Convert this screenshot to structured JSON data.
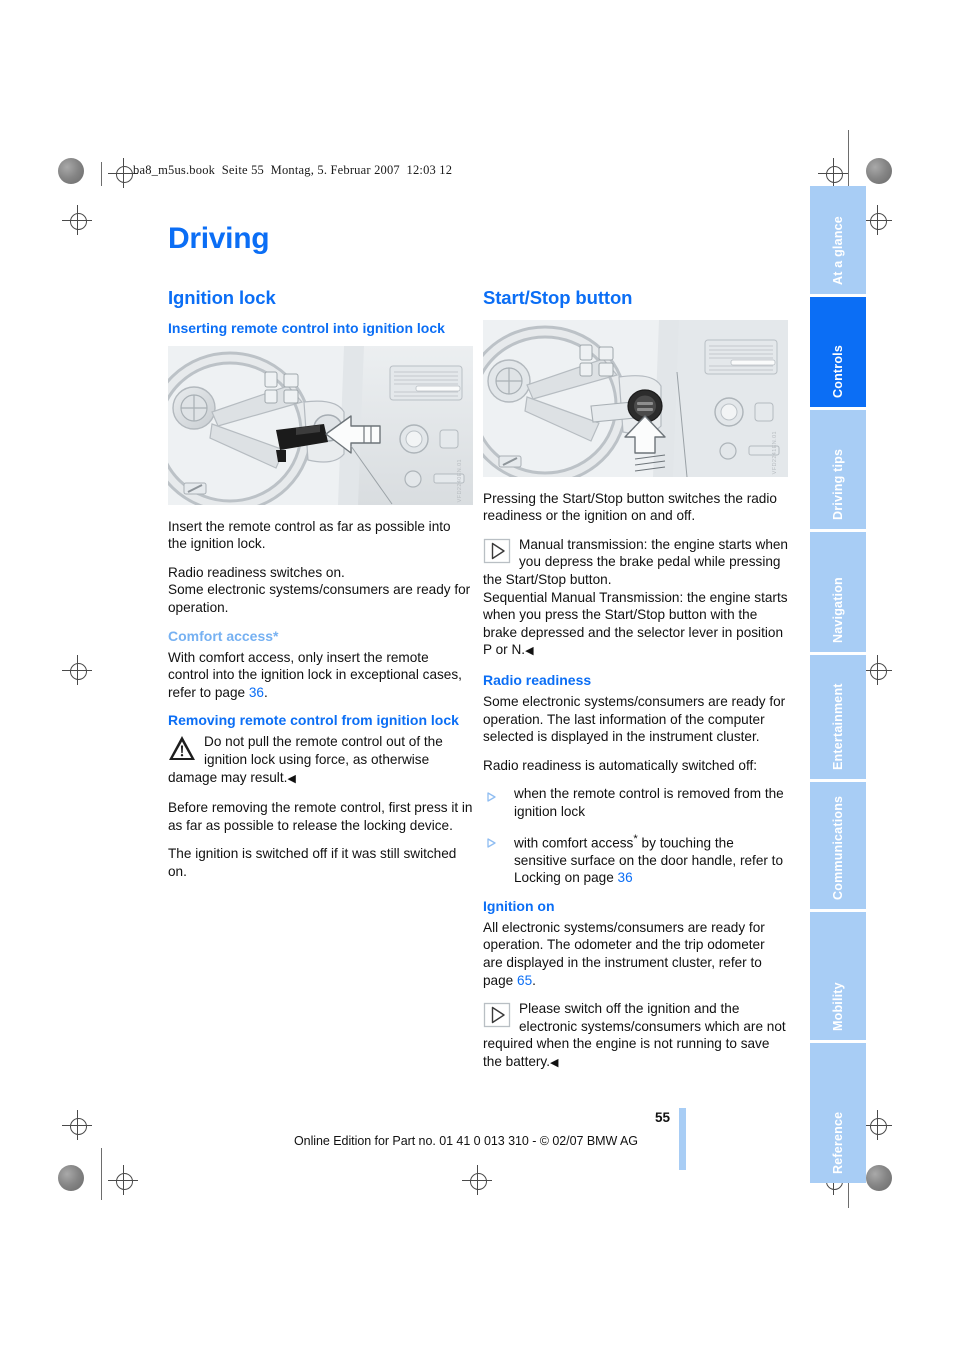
{
  "document": {
    "slug": "ba8_m5us.book  Seite 55  Montag, 5. Februar 2007  12:03 12",
    "chapter_title": "Driving",
    "page_number": "55",
    "footer": "Online Edition for Part no. 01 41 0 013 310 - © 02/07 BMW AG"
  },
  "left_column": {
    "section_title": "Ignition lock",
    "sub1_title": "Inserting remote control into ignition lock",
    "figure1_watermark": "VFD2240EN.01",
    "p1": "Insert the remote control as far as possible into the ignition lock.",
    "p2": "Radio readiness switches on.\nSome electronic systems/consumers are ready for operation.",
    "sub2_title": "Comfort access*",
    "p3_pre": "With comfort access, only insert the remote control into the ignition lock in exceptional cases, refer to page ",
    "p3_ref": "36",
    "p3_post": ".",
    "sub3_title": "Removing remote control from ignition lock",
    "warning_icon": "warning-triangle-icon",
    "warning_text": "Do not pull the remote control out of the ignition lock using force, as otherwise damage may result.",
    "warning_endmark": "◀",
    "p4": "Before removing the remote control, first press it in as far as possible to release the locking device.",
    "p5": "The ignition is switched off if it was still switched on."
  },
  "right_column": {
    "section_title": "Start/Stop button",
    "figure2_watermark": "VFD2241EN.01",
    "p1": "Pressing the Start/Stop button switches the radio readiness or the ignition on and off.",
    "note1_icon": "info-triangle-icon",
    "note1_text": "Manual transmission: the engine starts when you depress the brake pedal while pressing the Start/Stop button.\nSequential Manual Transmission: the engine starts when you press the Start/Stop button with the brake depressed and the selector lever in position P or N.",
    "note1_endmark": "◀",
    "sub1_title": "Radio readiness",
    "p2": "Some electronic systems/consumers are ready for operation. The last information of the computer selected is displayed in the instrument cluster.",
    "p3": "Radio readiness is automatically switched off:",
    "bullets": [
      {
        "text": "when the remote control is removed from the ignition lock"
      },
      {
        "text_pre": "with comfort access",
        "star": "*",
        "text_mid": " by touching the sensitive surface on the door handle, refer to Locking on page ",
        "ref": "36",
        "text_post": ""
      }
    ],
    "sub2_title": "Ignition on",
    "p4_pre": "All electronic systems/consumers are ready for operation. The odometer and the trip odometer are displayed in the instrument cluster, refer to page ",
    "p4_ref": "65",
    "p4_post": ".",
    "note2_icon": "info-triangle-icon",
    "note2_text": "Please switch off the ignition and the electronic systems/consumers which are not required when the engine is not running to save the battery.",
    "note2_endmark": "◀"
  },
  "rail": {
    "tabs": [
      {
        "label": "At a glance",
        "active": false
      },
      {
        "label": "Controls",
        "active": true
      },
      {
        "label": "Driving tips",
        "active": false
      },
      {
        "label": "Navigation",
        "active": false
      },
      {
        "label": "Entertainment",
        "active": false
      },
      {
        "label": "Communications",
        "active": false
      },
      {
        "label": "Mobility",
        "active": false
      },
      {
        "label": "Reference",
        "active": false
      }
    ]
  },
  "colors": {
    "accent_blue": "#0b6ef5",
    "soft_blue": "#a8cdf5",
    "light_heading_blue": "#76b1f2",
    "text": "#111111"
  }
}
